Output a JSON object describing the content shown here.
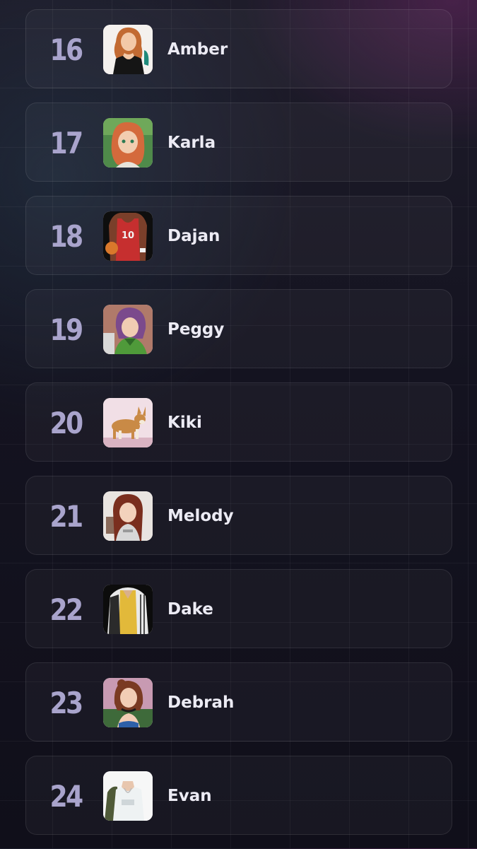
{
  "characters": [
    {
      "rank": "16",
      "name": "Amber",
      "avatar": "amber-portrait"
    },
    {
      "rank": "17",
      "name": "Karla",
      "avatar": "karla-portrait"
    },
    {
      "rank": "18",
      "name": "Dajan",
      "avatar": "dajan-portrait"
    },
    {
      "rank": "19",
      "name": "Peggy",
      "avatar": "peggy-portrait"
    },
    {
      "rank": "20",
      "name": "Kiki",
      "avatar": "kiki-corgi-portrait"
    },
    {
      "rank": "21",
      "name": "Melody",
      "avatar": "melody-portrait"
    },
    {
      "rank": "22",
      "name": "Dake",
      "avatar": "dake-portrait"
    },
    {
      "rank": "23",
      "name": "Debrah",
      "avatar": "debrah-portrait"
    },
    {
      "rank": "24",
      "name": "Evan",
      "avatar": "evan-portrait"
    }
  ],
  "colors": {
    "rank": "#a9a4cc",
    "name": "#ecebf4",
    "card_border": "rgba(255,255,255,0.09)"
  }
}
